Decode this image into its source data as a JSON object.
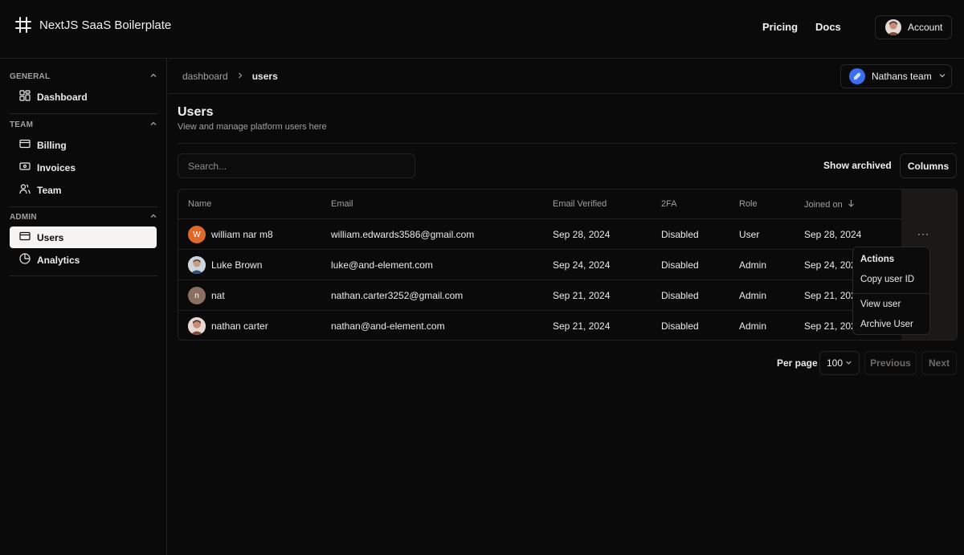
{
  "app": {
    "name": "NextJS SaaS Boilerplate"
  },
  "topnav": {
    "pricing": "Pricing",
    "docs": "Docs",
    "account": "Account"
  },
  "sidebar": {
    "sections": [
      {
        "title": "GENERAL",
        "items": [
          {
            "label": "Dashboard",
            "icon": "dashboard-icon"
          }
        ]
      },
      {
        "title": "TEAM",
        "items": [
          {
            "label": "Billing",
            "icon": "credit-card-icon"
          },
          {
            "label": "Invoices",
            "icon": "receipt-icon"
          },
          {
            "label": "Team",
            "icon": "users-icon"
          }
        ]
      },
      {
        "title": "ADMIN",
        "items": [
          {
            "label": "Users",
            "icon": "credit-card-icon",
            "active": true
          },
          {
            "label": "Analytics",
            "icon": "pie-chart-icon"
          }
        ]
      }
    ]
  },
  "breadcrumb": {
    "parent": "dashboard",
    "current": "users"
  },
  "team_switcher": {
    "label": "Nathans team"
  },
  "page": {
    "title": "Users",
    "subtitle": "View and manage platform users here"
  },
  "toolbar": {
    "search_placeholder": "Search...",
    "show_archived": "Show archived",
    "columns": "Columns"
  },
  "table": {
    "headers": {
      "name": "Name",
      "email": "Email",
      "verified": "Email Verified",
      "twofa": "2FA",
      "role": "Role",
      "joined": "Joined on"
    },
    "rows": [
      {
        "name": "william nar m8",
        "avatar_initial": "W",
        "avatar_color": "#e0692a",
        "email": "william.edwards3586@gmail.com",
        "verified": "Sep 28, 2024",
        "twofa": "Disabled",
        "role": "User",
        "joined": "Sep 28, 2024"
      },
      {
        "name": "Luke Brown",
        "avatar_initial": "",
        "avatar_color": "#c9c4c0",
        "email": "luke@and-element.com",
        "verified": "Sep 24, 2024",
        "twofa": "Disabled",
        "role": "Admin",
        "joined": "Sep 24, 2024"
      },
      {
        "name": "nat",
        "avatar_initial": "n",
        "avatar_color": "#8a6f62",
        "email": "nathan.carter3252@gmail.com",
        "verified": "Sep 21, 2024",
        "twofa": "Disabled",
        "role": "Admin",
        "joined": "Sep 21, 2024"
      },
      {
        "name": "nathan carter",
        "avatar_initial": "",
        "avatar_color": "#d9cdc6",
        "email": "nathan@and-element.com",
        "verified": "Sep 21, 2024",
        "twofa": "Disabled",
        "role": "Admin",
        "joined": "Sep 21, 2024"
      }
    ],
    "actions_glyph": "···"
  },
  "actions_menu": {
    "title": "Actions",
    "copy_id": "Copy user ID",
    "view": "View user",
    "archive": "Archive User"
  },
  "pagination": {
    "per_page_label": "Per page",
    "per_page_value": "100",
    "previous": "Previous",
    "next": "Next"
  },
  "colors": {
    "background": "#0b0a0a",
    "border": "#232120",
    "active_item": "#f5f4f3",
    "team_logo": "#3a6df0"
  }
}
